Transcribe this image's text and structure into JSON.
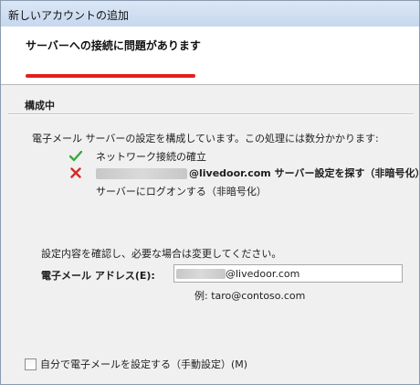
{
  "window": {
    "title": "新しいアカウントの追加"
  },
  "header": {
    "title": "サーバーへの接続に問題があります",
    "highlight_color": "#e02020"
  },
  "section": {
    "title": "構成中"
  },
  "description": "電子メール サーバーの設定を構成しています。この処理には数分かかります:",
  "steps": [
    {
      "icon": "check-icon",
      "status_color": "#3aa93a",
      "text": "ネットワーク接続の確立"
    },
    {
      "icon": "x-icon",
      "status_color": "#d62a2a",
      "text_bold": "@livedoor.com サーバー設定を探す（非暗号化）"
    },
    {
      "icon": "",
      "text": "サーバーにログオンする（非暗号化）"
    }
  ],
  "confirm_text": "設定内容を確認し、必要な場合は変更してください。",
  "email": {
    "label": "電子メール アドレス(E):",
    "value_suffix": "@livedoor.com",
    "example": "例: taro@contoso.com"
  },
  "manual": {
    "label": "自分で電子メールを設定する（手動設定）(M)",
    "checked": false
  }
}
